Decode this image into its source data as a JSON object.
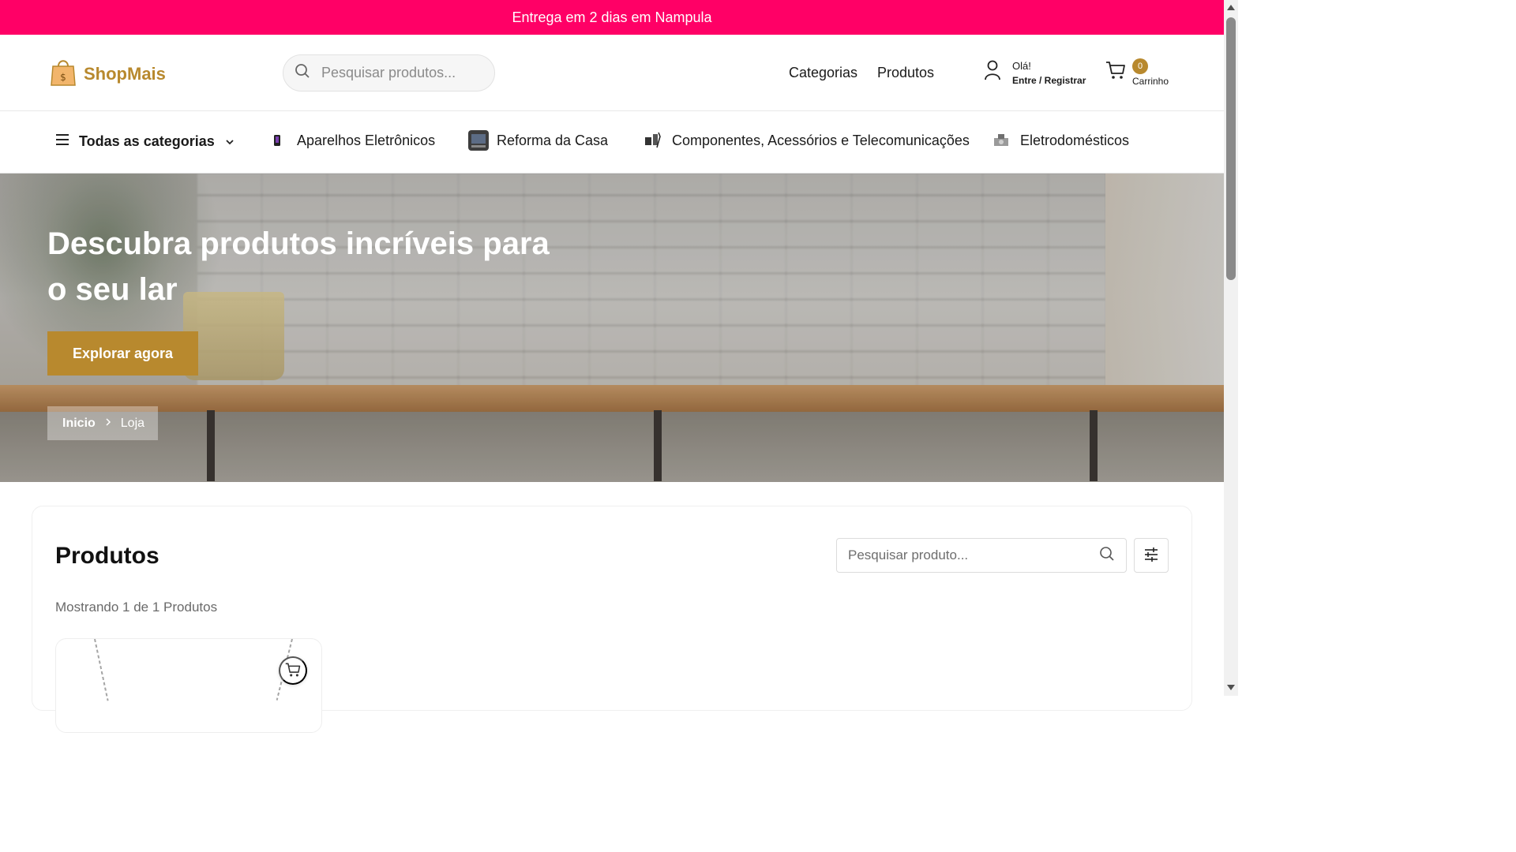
{
  "announcement": "Entrega em 2 dias em Nampula",
  "header": {
    "logo_text": "ShopMais",
    "search_placeholder": "Pesquisar produtos...",
    "nav": [
      "Categorias",
      "Produtos"
    ],
    "account_greeting": "Olá!",
    "account_action": "Entre / Registrar",
    "cart_count": "0",
    "cart_label": "Carrinho"
  },
  "category_bar": {
    "all_label": "Todas as categorias",
    "items": [
      {
        "label": "Aparelhos Eletrônicos",
        "icon": "phone-icon"
      },
      {
        "label": "Reforma da Casa",
        "icon": "tool-icon"
      },
      {
        "label": "Componentes, Acessórios e Telecomunicações",
        "icon": "accessories-icon"
      },
      {
        "label": "Eletrodomésticos",
        "icon": "appliance-icon"
      }
    ]
  },
  "hero": {
    "title": "Descubra produtos incríveis para o seu lar",
    "cta": "Explorar agora",
    "breadcrumb": [
      "Inicio",
      "Loja"
    ]
  },
  "products": {
    "title": "Produtos",
    "search_placeholder": "Pesquisar produto...",
    "showing": "Mostrando 1 de 1 Produtos"
  },
  "colors": {
    "announce_bg": "#ff0066",
    "brand_gold": "#b8892e"
  }
}
